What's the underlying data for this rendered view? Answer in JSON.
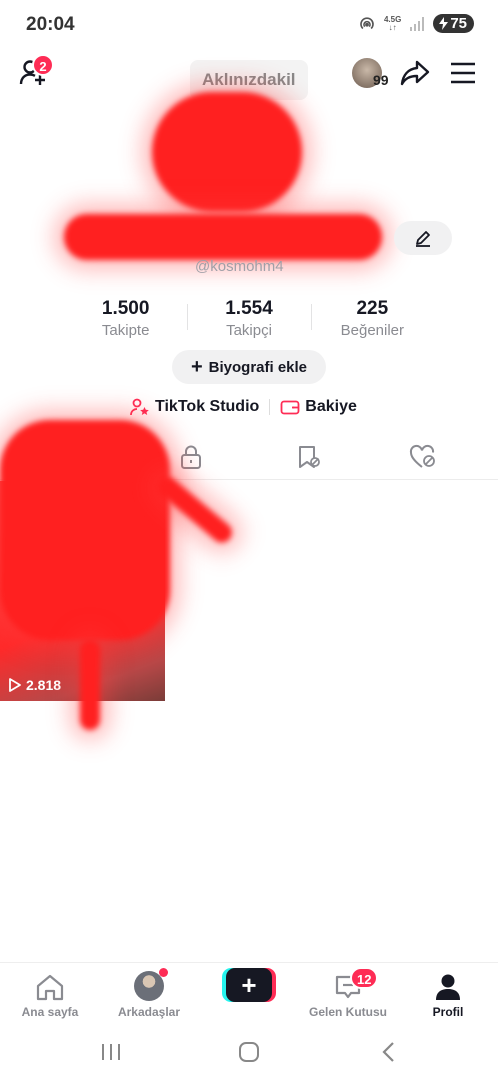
{
  "status_bar": {
    "time": "20:04",
    "network": "4.5G",
    "battery": "75"
  },
  "top_bar": {
    "friend_badge": "2",
    "username": "Aklınızdakil",
    "story_count": "99"
  },
  "profile": {
    "handle": "@kosmohm4"
  },
  "stats": [
    {
      "value": "1.500",
      "label": "Takipte"
    },
    {
      "value": "1.554",
      "label": "Takipçi"
    },
    {
      "value": "225",
      "label": "Beğeniler"
    }
  ],
  "bio_button": {
    "plus": "+",
    "label": "Biyografi ekle"
  },
  "links": {
    "studio": "TikTok Studio",
    "balance": "Bakiye"
  },
  "video": {
    "views": "2.818"
  },
  "bottom_nav": {
    "home": "Ana sayfa",
    "friends": "Arkadaşlar",
    "create": "+",
    "inbox": "Gelen Kutusu",
    "inbox_badge": "12",
    "profile": "Profil"
  },
  "colors": {
    "accent": "#fe2c55",
    "cyan": "#25f4ee",
    "text": "#161823",
    "muted": "#8a8b91"
  }
}
